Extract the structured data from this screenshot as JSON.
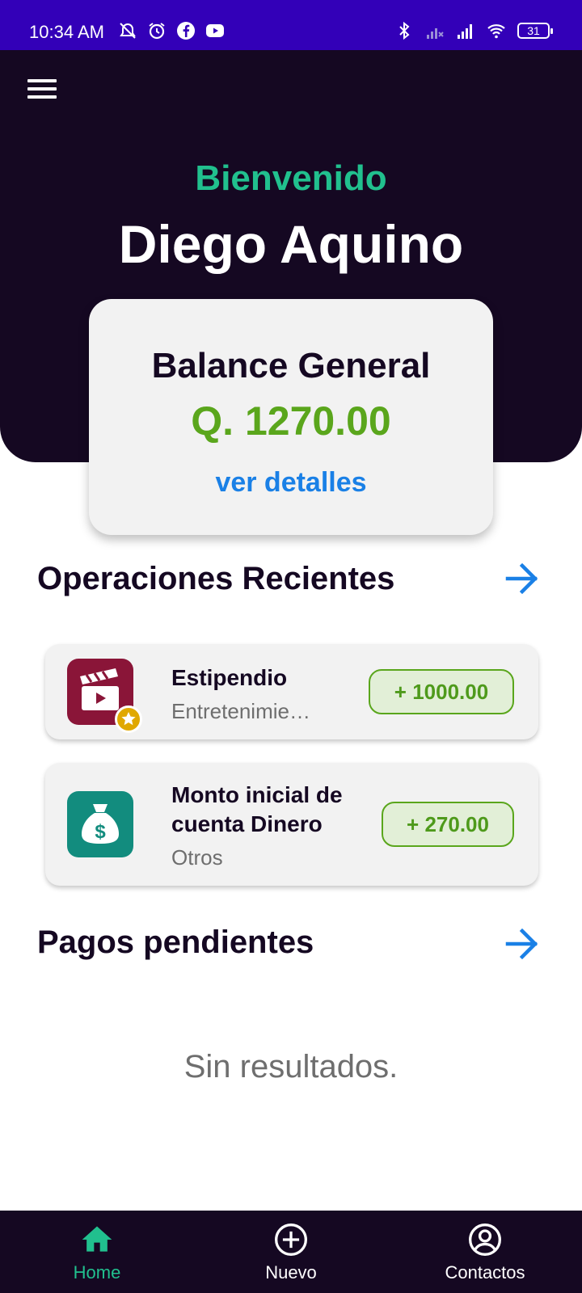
{
  "status_bar": {
    "time": "10:34 AM",
    "battery": "31",
    "icons_left": [
      "alarm-off-icon",
      "alarm-icon",
      "facebook-icon",
      "youtube-icon"
    ],
    "icons_right": [
      "bluetooth-icon",
      "signal-no-service-icon",
      "signal-icon",
      "wifi-icon",
      "battery-icon"
    ]
  },
  "header": {
    "welcome": "Bienvenido",
    "user_name": "Diego Aquino",
    "menu_icon": "hamburger-menu-icon"
  },
  "balance": {
    "title": "Balance General",
    "amount": "Q. 1270.00",
    "details_link": "ver detalles"
  },
  "recent_operations": {
    "title": "Operaciones Recientes",
    "arrow_icon": "arrow-right-icon",
    "items": [
      {
        "title": "Estipendio",
        "subtitle": "Entretenimie…",
        "amount": "+ 1000.00",
        "icon": "clapperboard-icon",
        "badge_icon": "star-icon",
        "icon_color": "#8a1538"
      },
      {
        "title": "Monto inicial de cuenta Dinero",
        "subtitle": "Otros",
        "amount": "+ 270.00",
        "icon": "money-bag-icon",
        "icon_color": "#128c7e"
      }
    ]
  },
  "pending_payments": {
    "title": "Pagos pendientes",
    "arrow_icon": "arrow-right-icon",
    "empty_text": "Sin resultados."
  },
  "bottom_nav": {
    "items": [
      {
        "label": "Home",
        "icon": "home-icon",
        "active": true
      },
      {
        "label": "Nuevo",
        "icon": "add-circle-icon",
        "active": false
      },
      {
        "label": "Contactos",
        "icon": "account-circle-icon",
        "active": false
      }
    ]
  },
  "colors": {
    "status_bar": "#3300b8",
    "header_bg": "#150822",
    "accent_teal": "#21c08e",
    "amount_green": "#5aa61c",
    "link_blue": "#1a80e6",
    "card_bg": "#f2f2f2"
  }
}
